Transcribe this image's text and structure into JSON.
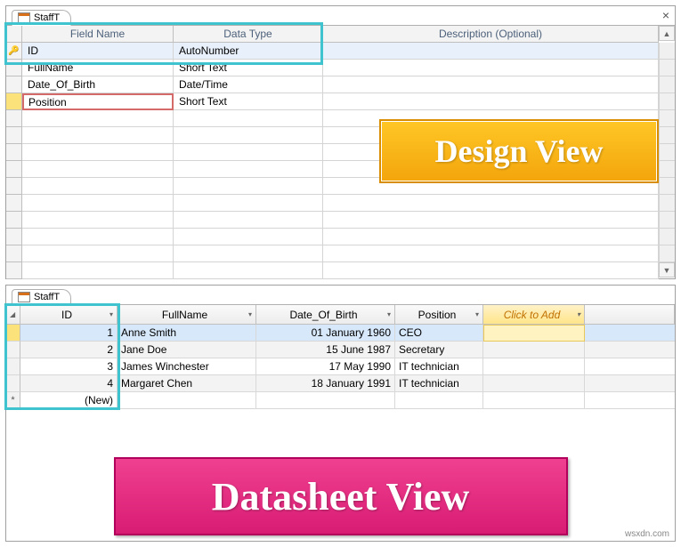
{
  "watermark": "wsxdn.com",
  "design_view": {
    "tab_title": "StaffT",
    "label": "Design View",
    "headers": {
      "field_name": "Field Name",
      "data_type": "Data Type",
      "description": "Description (Optional)"
    },
    "rows": [
      {
        "field": "ID",
        "type": "AutoNumber",
        "pk": true,
        "selected": false
      },
      {
        "field": "FullName",
        "type": "Short Text",
        "pk": false,
        "selected": false
      },
      {
        "field": "Date_Of_Birth",
        "type": "Date/Time",
        "pk": false,
        "selected": false
      },
      {
        "field": "Position",
        "type": "Short Text",
        "pk": false,
        "selected": true
      }
    ]
  },
  "datasheet_view": {
    "tab_title": "StaffT",
    "label": "Datasheet View",
    "headers": {
      "id": "ID",
      "fullname": "FullName",
      "dob": "Date_Of_Birth",
      "position": "Position",
      "add": "Click to Add"
    },
    "rows": [
      {
        "id": "1",
        "fullname": "Anne Smith",
        "dob": "01 January 1960",
        "position": "CEO"
      },
      {
        "id": "2",
        "fullname": "Jane Doe",
        "dob": "15 June 1987",
        "position": "Secretary"
      },
      {
        "id": "3",
        "fullname": "James Winchester",
        "dob": "17 May 1990",
        "position": "IT technician"
      },
      {
        "id": "4",
        "fullname": "Margaret Chen",
        "dob": "18 January 1991",
        "position": "IT technician"
      }
    ],
    "new_row_label": "(New)"
  }
}
